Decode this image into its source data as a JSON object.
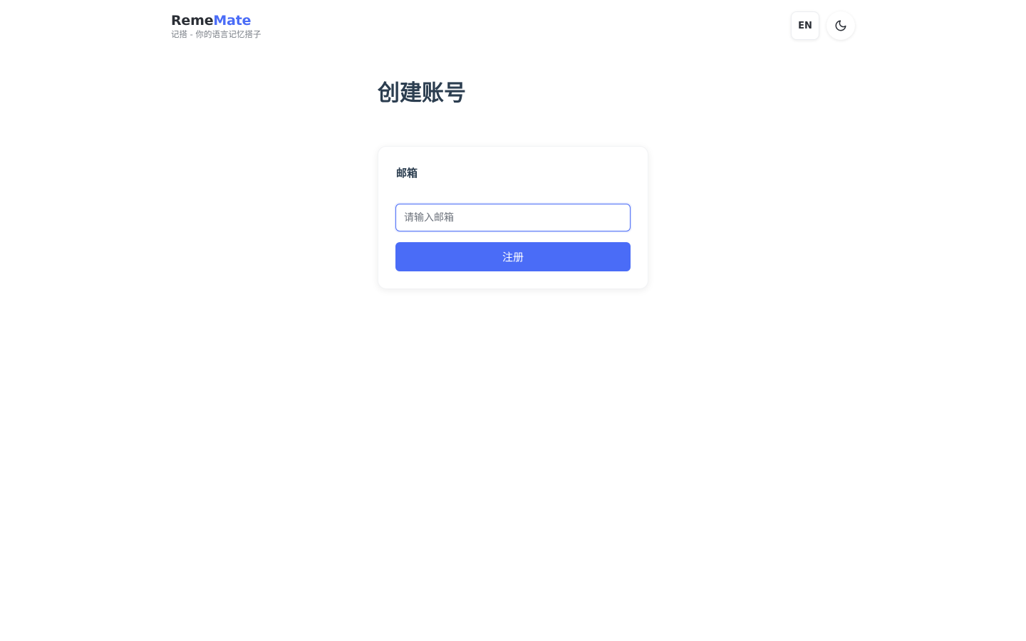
{
  "header": {
    "brand": {
      "name_part_1": "Reme",
      "name_part_2": "Mate",
      "tagline": "记搭 - 你的语言记忆搭子"
    },
    "language_toggle_label": "EN",
    "theme_toggle_icon": "moon-icon"
  },
  "main": {
    "title": "创建账号",
    "form": {
      "email_label": "邮箱",
      "email_value": "",
      "email_placeholder": "请输入邮箱",
      "submit_label": "注册"
    }
  },
  "colors": {
    "accent": "#4a6cf7",
    "heading": "#2c3e50",
    "brand_dark": "#2b2f36",
    "muted": "#7a7f87"
  }
}
